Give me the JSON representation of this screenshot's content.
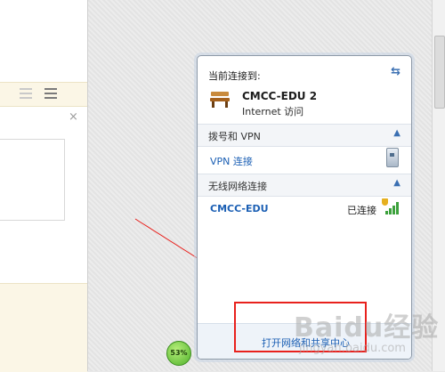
{
  "left_window": {
    "close_glyph": "×"
  },
  "popup": {
    "header": "当前连接到:",
    "refresh_glyph": "⇆",
    "current_network": {
      "name": "CMCC-EDU  2",
      "access": "Internet 访问"
    },
    "dialup_section": {
      "title": "拨号和 VPN",
      "caret": "▲"
    },
    "vpn_link": "VPN 连接",
    "wireless_section": {
      "title": "无线网络连接",
      "caret": "▲"
    },
    "wireless_network": {
      "name": "CMCC-EDU",
      "status": "已连接"
    },
    "footer_link": "打开网络和共享中心"
  },
  "progress_badge": "53%",
  "watermark": {
    "main": "Baidu经验",
    "sub": "jingyan.baidu.com"
  },
  "colors": {
    "link": "#1b5fb4",
    "highlight": "#e8211d",
    "signal": "#3ca13c"
  }
}
